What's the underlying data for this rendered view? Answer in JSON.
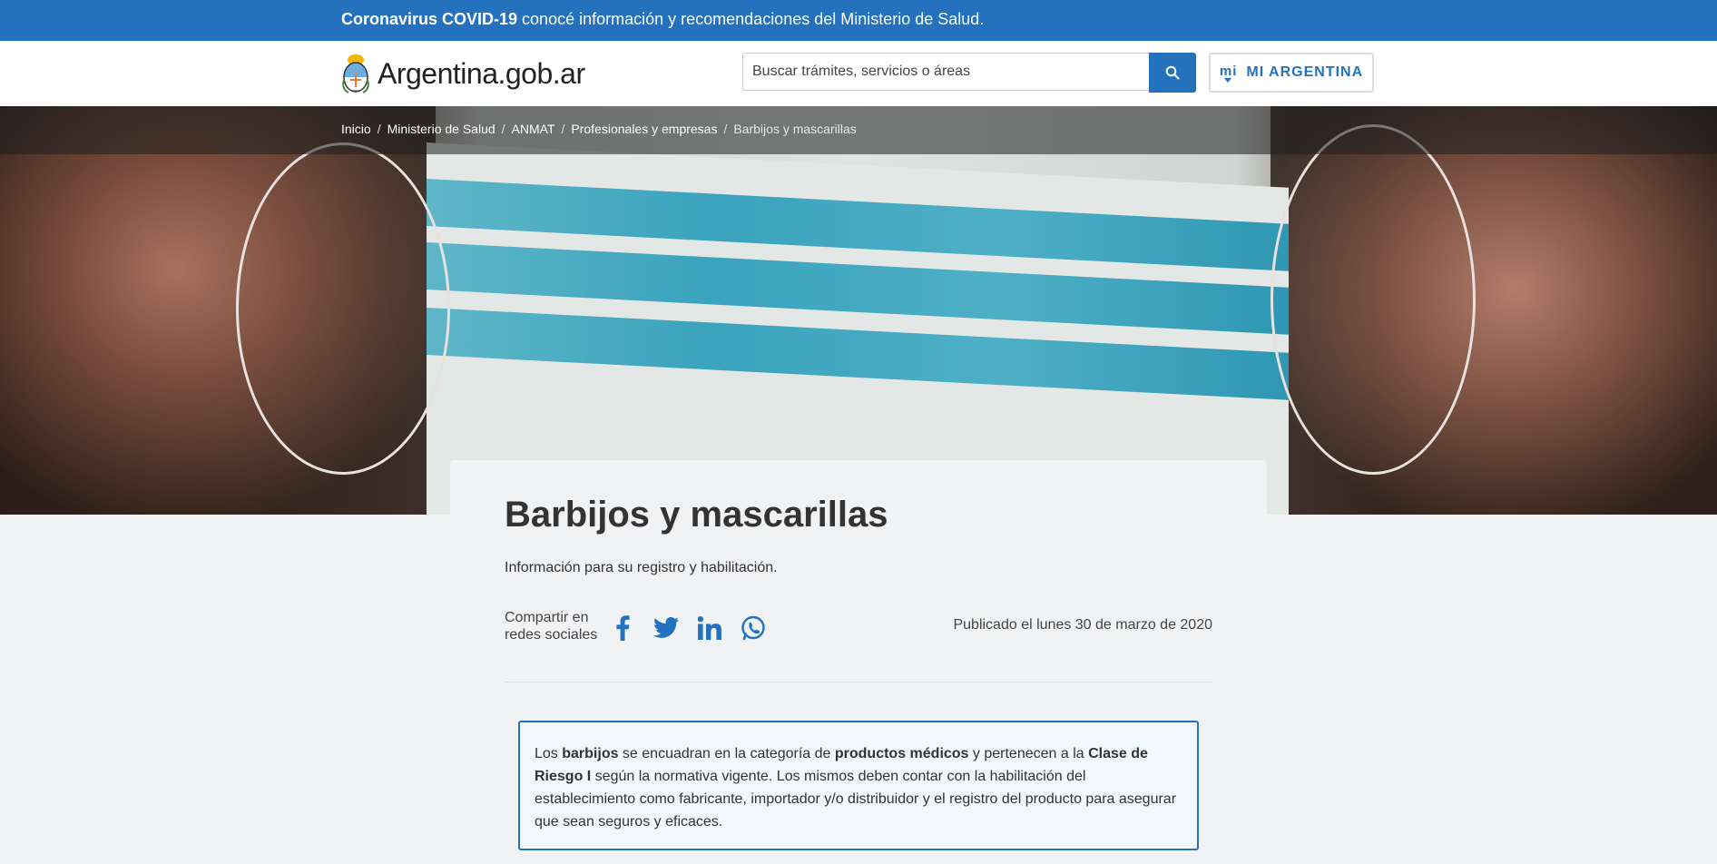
{
  "alert": {
    "bold": "Coronavirus COVID-19",
    "text": " conocé información y recomendaciones del Ministerio de Salud."
  },
  "header": {
    "logo_text": "Argentina.gob.ar",
    "search_placeholder": "Buscar trámites, servicios o áreas",
    "mi_logo": "mi",
    "mi_label": "MI ARGENTINA"
  },
  "breadcrumb": {
    "items": [
      "Inicio",
      "Ministerio de Salud",
      "ANMAT",
      "Profesionales y empresas"
    ],
    "current": "Barbijos y mascarillas",
    "separator": "/"
  },
  "page": {
    "title": "Barbijos y mascarillas",
    "subtitle": "Información para su registro y habilitación.",
    "share_label": "Compartir en redes sociales",
    "published": "Publicado el lunes 30 de marzo de 2020"
  },
  "share_icons": [
    "facebook-icon",
    "twitter-icon",
    "linkedin-icon",
    "whatsapp-icon"
  ],
  "info_box": {
    "t1": "Los ",
    "b1": "barbijos",
    "t2": " se encuadran en la categoría de ",
    "b2": "productos médicos",
    "t3": " y pertenecen a la ",
    "b3": "Clase de Riesgo I",
    "t4": " según la normativa vigente. Los mismos deben contar con la habilitación del establecimiento como fabricante, importador y/o distribuidor y el registro del producto para asegurar que sean seguros y eficaces."
  },
  "colors": {
    "primary": "#2471bd",
    "background": "#f1f2f4"
  }
}
